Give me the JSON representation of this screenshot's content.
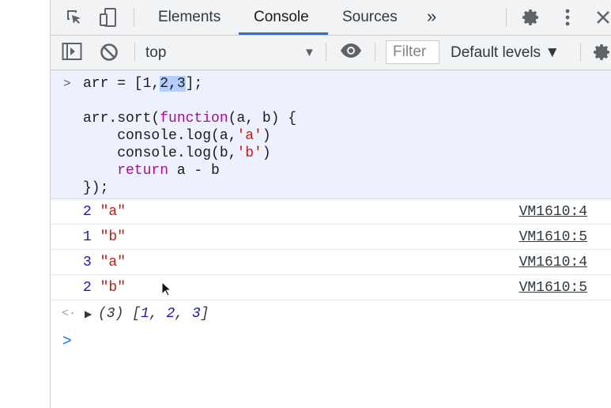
{
  "tabs": [
    {
      "label": "Elements"
    },
    {
      "label": "Console"
    },
    {
      "label": "Sources"
    }
  ],
  "active_tab": "Console",
  "more_tabs_glyph": "»",
  "toolbar": {
    "context": "top",
    "filter_placeholder": "Filter",
    "levels": "Default levels ▼"
  },
  "input_code": {
    "line1": {
      "a": "arr = [1,",
      "sel": "2,3",
      "b": "];"
    },
    "line2": {
      "a": "arr.sort(",
      "kw": "function",
      "b": "(a, b) {"
    },
    "line3": {
      "a": "    console.log(a,",
      "s": "'a'",
      "b": ")"
    },
    "line4": {
      "a": "    console.log(b,",
      "s": "'b'",
      "b": ")"
    },
    "line5": {
      "kw": "    return",
      "b": " a - b"
    },
    "line6": "});"
  },
  "logs": [
    {
      "num": "2",
      "str": "\"a\"",
      "source": "VM1610:4"
    },
    {
      "num": "1",
      "str": "\"b\"",
      "source": "VM1610:5"
    },
    {
      "num": "3",
      "str": "\"a\"",
      "source": "VM1610:4"
    },
    {
      "num": "2",
      "str": "\"b\"",
      "source": "VM1610:5"
    }
  ],
  "result": {
    "prefix": "(3) [",
    "v1": "1",
    "v2": "2",
    "v3": "3",
    "suffix": "]"
  },
  "icons": [
    "inspect-element-icon",
    "device-toolbar-icon",
    "settings-gear-icon",
    "more-vert-icon",
    "close-icon",
    "sidebar-toggle-icon",
    "clear-console-icon",
    "eye-icon",
    "console-settings-icon"
  ],
  "colors": {
    "accent": "#1a73e8",
    "number": "#1a1aa6",
    "string": "#c41a16",
    "keyword": "#aa0d91",
    "input_bg": "#ecf1fd"
  }
}
